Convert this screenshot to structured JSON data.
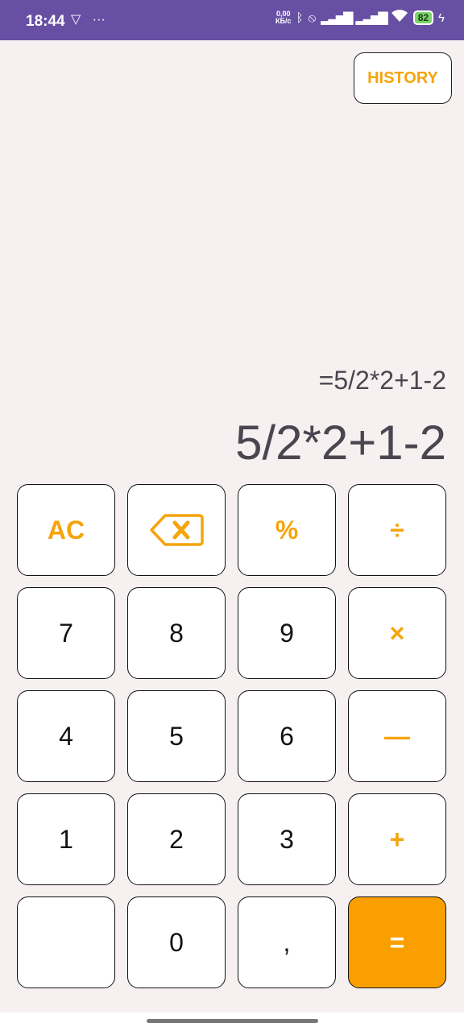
{
  "status_bar": {
    "time": "18:44",
    "net_speed_value": "0,00",
    "net_speed_unit": "КБ/с",
    "battery": "82",
    "icons": [
      "vpn-icon",
      "more-icon",
      "bluetooth-icon",
      "vibrate-off-icon",
      "signal-icon",
      "signal-icon",
      "wifi-icon",
      "battery-icon",
      "charging-icon"
    ]
  },
  "header": {
    "history_label": "HISTORY"
  },
  "display": {
    "expression": "=5/2*2+1-2",
    "result": "5/2*2+1-2"
  },
  "keys": {
    "ac": "AC",
    "backspace_icon": "backspace-icon",
    "percent": "%",
    "divide": "÷",
    "seven": "7",
    "eight": "8",
    "nine": "9",
    "multiply": "×",
    "four": "4",
    "five": "5",
    "six": "6",
    "minus": "—",
    "one": "1",
    "two": "2",
    "three": "3",
    "plus": "+",
    "blank": "",
    "zero": "0",
    "comma": ",",
    "equals": "="
  },
  "colors": {
    "accent": "#f5a40b",
    "equals_bg": "#f9a000",
    "status_bar": "#6750a4",
    "background": "#f6f0f0"
  }
}
